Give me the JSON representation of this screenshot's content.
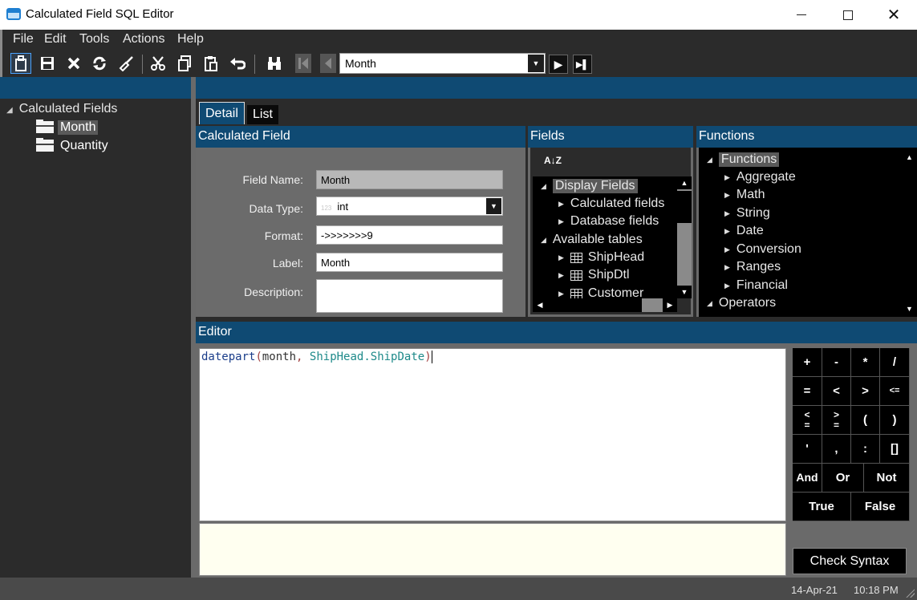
{
  "window": {
    "title": "Calculated Field SQL Editor",
    "minimize_glyph": "",
    "close_glyph": "✕"
  },
  "menu": [
    "File",
    "Edit",
    "Tools",
    "Actions",
    "Help"
  ],
  "toolbar": {
    "icons": [
      "new-icon",
      "save-icon",
      "delete-icon",
      "refresh-icon",
      "clear-icon",
      "cut-icon",
      "copy-icon",
      "paste-icon",
      "undo-icon",
      "search-icon",
      "first-record-icon",
      "previous-record-icon"
    ],
    "nav_combo_value": "Month",
    "next_glyph": "▶",
    "last_glyph": "▶▌"
  },
  "tree": {
    "root": "Calculated Fields",
    "nodes": [
      "Month",
      "Quantity"
    ]
  },
  "tabs": {
    "detail": "Detail",
    "list": "List"
  },
  "calculated_field": {
    "header": "Calculated Field",
    "field_name_label": "Field Name:",
    "field_name_value": "Month",
    "data_type_label": "Data Type:",
    "data_type_prefix": "123",
    "data_type_value": "int",
    "format_label": "Format:",
    "format_value": "->>>>>>>9",
    "label_label": "Label:",
    "label_value": "Month",
    "description_label": "Description:",
    "description_value": ""
  },
  "fields": {
    "header": "Fields",
    "sort_glyph": "A↓Z",
    "items": {
      "display_fields": "Display Fields",
      "calculated_fields": "Calculated fields",
      "database_fields": "Database fields",
      "available_tables": "Available tables",
      "shiphead": "ShipHead",
      "shipdtl": "ShipDtl",
      "customer": "Customer"
    }
  },
  "functions": {
    "header": "Functions",
    "root": "Functions",
    "items": [
      "Aggregate",
      "Math",
      "String",
      "Date",
      "Conversion",
      "Ranges",
      "Financial"
    ],
    "operators": "Operators"
  },
  "editor": {
    "header": "Editor",
    "code": {
      "func": "datepart",
      "open": "(",
      "arg": "month",
      "comma": ",",
      "field": "ShipHead.ShipDate",
      "close": ")"
    },
    "message": ""
  },
  "keypad": {
    "plus": "+",
    "minus": "-",
    "times": "*",
    "divide": "/",
    "eq": "=",
    "lt": "<",
    "gt": ">",
    "lte": "<=",
    "gte_top": "<",
    "gte_bot": "=",
    "ne_top": ">",
    "ne_bot": "=",
    "lparen": "(",
    "rparen": ")",
    "quote": "'",
    "comma": ",",
    "colon": ":",
    "brackets": "[]",
    "and": "And",
    "or": "Or",
    "not": "Not",
    "true": "True",
    "false": "False",
    "check_syntax": "Check Syntax"
  },
  "status": {
    "date": "14-Apr-21",
    "time": "10:18 PM"
  }
}
